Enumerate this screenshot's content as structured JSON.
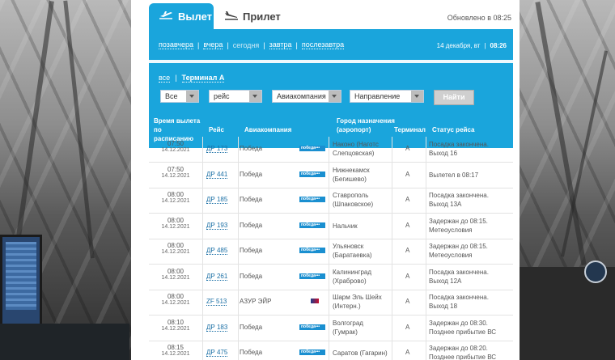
{
  "tabs": {
    "departure": "Вылет",
    "arrival": "Прилет"
  },
  "updated": "Обновлено в 08:25",
  "days": {
    "day_before": "позавчера",
    "yesterday": "вчера",
    "today": "сегодня",
    "tomorrow": "завтра",
    "day_after": "послезавтра"
  },
  "current_date": {
    "date": "14 декабря, вт",
    "time": "08:26"
  },
  "filters": {
    "all": "все",
    "terminal": "Терминал А",
    "select_all": "Все",
    "select_flight": "рейс",
    "select_airline": "Авиакомпания",
    "select_direction": "Направление",
    "find": "Найти"
  },
  "table": {
    "headers": {
      "time": "Время вылета по расписанию",
      "flight": "Рейс",
      "airline": "Авиакомпания",
      "city": "Город назначения (аэропорт)",
      "terminal": "Терминал",
      "status": "Статус рейса"
    },
    "rows": [
      {
        "time": "07:50",
        "date": "14.12.2021",
        "flight": "ДР 173",
        "airline": "Победа",
        "logo": "pobeda",
        "city1": "Наконо (Наготс",
        "city2": "Слепцовская)",
        "terminal": "A",
        "status1": "Посадка закончена.",
        "status2": "Выход 16"
      },
      {
        "time": "07:50",
        "date": "14.12.2021",
        "flight": "ДР 441",
        "airline": "Победа",
        "logo": "pobeda",
        "city1": "Нижнекамск",
        "city2": "(Бегишево)",
        "terminal": "A",
        "status1": "Вылетел в 08:17",
        "status2": ""
      },
      {
        "time": "08:00",
        "date": "14.12.2021",
        "flight": "ДР 185",
        "airline": "Победа",
        "logo": "pobeda",
        "city1": "Ставрополь",
        "city2": "(Шпаковское)",
        "terminal": "A",
        "status1": "Посадка закончена.",
        "status2": "Выход 13А"
      },
      {
        "time": "08:00",
        "date": "14.12.2021",
        "flight": "ДР 193",
        "airline": "Победа",
        "logo": "pobeda",
        "city1": "Нальчик",
        "city2": "",
        "terminal": "A",
        "status1": "Задержан до 08:15.",
        "status2": "Метеоусловия"
      },
      {
        "time": "08:00",
        "date": "14.12.2021",
        "flight": "ДР 485",
        "airline": "Победа",
        "logo": "pobeda",
        "city1": "Ульяновск",
        "city2": "(Баратаевка)",
        "terminal": "A",
        "status1": "Задержан до 08:15.",
        "status2": "Метеоусловия"
      },
      {
        "time": "08:00",
        "date": "14.12.2021",
        "flight": "ДР 261",
        "airline": "Победа",
        "logo": "pobeda",
        "city1": "Калининград",
        "city2": "(Храброво)",
        "terminal": "A",
        "status1": "Посадка закончена.",
        "status2": "Выход 12А"
      },
      {
        "time": "08:00",
        "date": "14.12.2021",
        "flight": "ZF 513",
        "airline": "АЗУР ЭЙР",
        "logo": "azur",
        "city1": "Шарм Эль Шейх",
        "city2": "(Интерн.)",
        "terminal": "A",
        "status1": "Посадка закончена.",
        "status2": "Выход 18"
      },
      {
        "time": "08:10",
        "date": "14.12.2021",
        "flight": "ДР 183",
        "airline": "Победа",
        "logo": "pobeda",
        "city1": "Волгоград",
        "city2": "(Гумрак)",
        "terminal": "A",
        "status1": "Задержан до 08:30.",
        "status2": "Позднее прибытие ВС"
      },
      {
        "time": "08:15",
        "date": "14.12.2021",
        "flight": "ДР 475",
        "airline": "Победа",
        "logo": "pobeda",
        "city1": "Саратов (Гагарин)",
        "city2": "",
        "terminal": "A",
        "status1": "Задержан до 08:20.",
        "status2": "Позднее прибытие ВС"
      }
    ]
  },
  "logo_text": {
    "pobeda": "победа•••"
  },
  "colors": {
    "accent": "#1aa5dc",
    "link": "#1a6fa5"
  }
}
